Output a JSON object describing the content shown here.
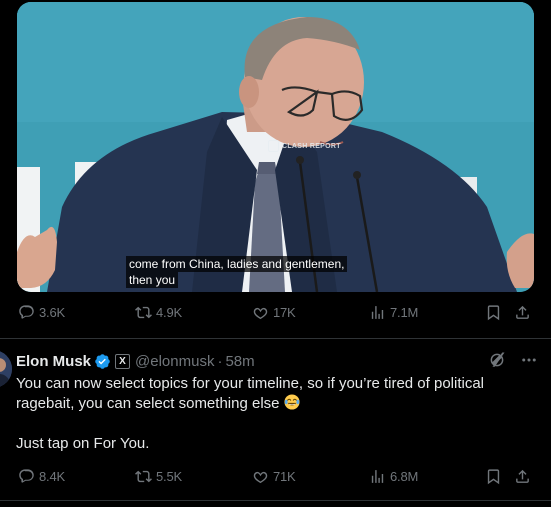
{
  "video": {
    "watermark": "CLASH REPORT",
    "subtitle_line1": "come from China, ladies and gentlemen,",
    "subtitle_line2": "then you"
  },
  "tweet1": {
    "replies": "3.6K",
    "reposts": "4.9K",
    "likes": "17K",
    "views": "7.1M"
  },
  "tweet2": {
    "name": "Elon Musk",
    "affiliate_badge": "X",
    "handle": "@elonmusk",
    "separator": "·",
    "time": "58m",
    "text_line1": "You can now select topics for your timeline, so if you’re tired of political ragebait, you can select something else",
    "text_line2": "Just tap on For You.",
    "emoji": "joy-emoji",
    "replies": "8.4K",
    "reposts": "5.5K",
    "likes": "71K",
    "views": "6.8M"
  },
  "colors": {
    "background": "#000000",
    "text": "#e7e9ea",
    "muted": "#71767b",
    "verified": "#1d9bf0",
    "divider": "#2f3336"
  }
}
